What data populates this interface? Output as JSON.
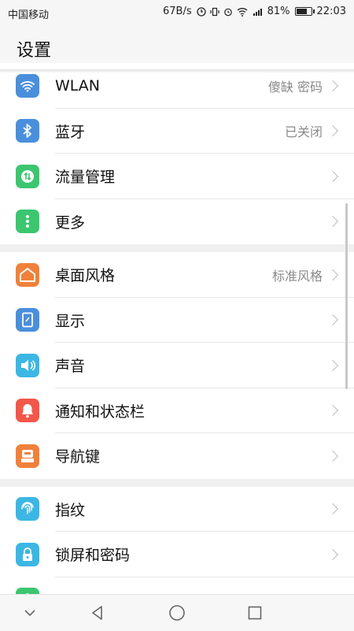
{
  "status_bar": {
    "carrier": "中国移动",
    "speed": "67B/s",
    "battery": "81%",
    "battery_level": 0.81,
    "time": "22:03",
    "icons": [
      "data-saver-icon",
      "vibrate-icon",
      "alarm-icon",
      "wifi-icon",
      "signal-4g-icon",
      "battery-icon"
    ]
  },
  "header": {
    "title": "设置"
  },
  "groups": [
    {
      "items": [
        {
          "name": "wlan",
          "label": "WLAN",
          "value": "傻缺 密码",
          "icon": "wifi-icon",
          "color": "#4a8fdc"
        },
        {
          "name": "bluetooth",
          "label": "蓝牙",
          "value": "已关闭",
          "icon": "bluetooth-icon",
          "color": "#4a8fdc"
        },
        {
          "name": "data-usage",
          "label": "流量管理",
          "value": "",
          "icon": "data-usage-icon",
          "color": "#3cc66f"
        },
        {
          "name": "more",
          "label": "更多",
          "value": "",
          "icon": "more-dots-icon",
          "color": "#3cc66f"
        }
      ]
    },
    {
      "items": [
        {
          "name": "home-style",
          "label": "桌面风格",
          "value": "标准风格",
          "icon": "home-icon",
          "color": "#f0813a"
        },
        {
          "name": "display",
          "label": "显示",
          "value": "",
          "icon": "display-icon",
          "color": "#4a8fdc"
        },
        {
          "name": "sound",
          "label": "声音",
          "value": "",
          "icon": "speaker-icon",
          "color": "#3cb7e3"
        },
        {
          "name": "notifications",
          "label": "通知和状态栏",
          "value": "",
          "icon": "bell-icon",
          "color": "#f2574a"
        },
        {
          "name": "nav-keys",
          "label": "导航键",
          "value": "",
          "icon": "navigation-key-icon",
          "color": "#f0813a"
        }
      ]
    },
    {
      "items": [
        {
          "name": "fingerprint",
          "label": "指纹",
          "value": "",
          "icon": "fingerprint-icon",
          "color": "#3cb7e3"
        },
        {
          "name": "lock-screen",
          "label": "锁屏和密码",
          "value": "",
          "icon": "lock-icon",
          "color": "#3cb7e3"
        },
        {
          "name": "security",
          "label": "",
          "value": "",
          "icon": "shield-icon",
          "color": "#3cc66f"
        }
      ]
    }
  ],
  "nav_bar": {
    "buttons": [
      "hide-nav-icon",
      "back-icon",
      "home-icon",
      "recents-icon"
    ]
  }
}
